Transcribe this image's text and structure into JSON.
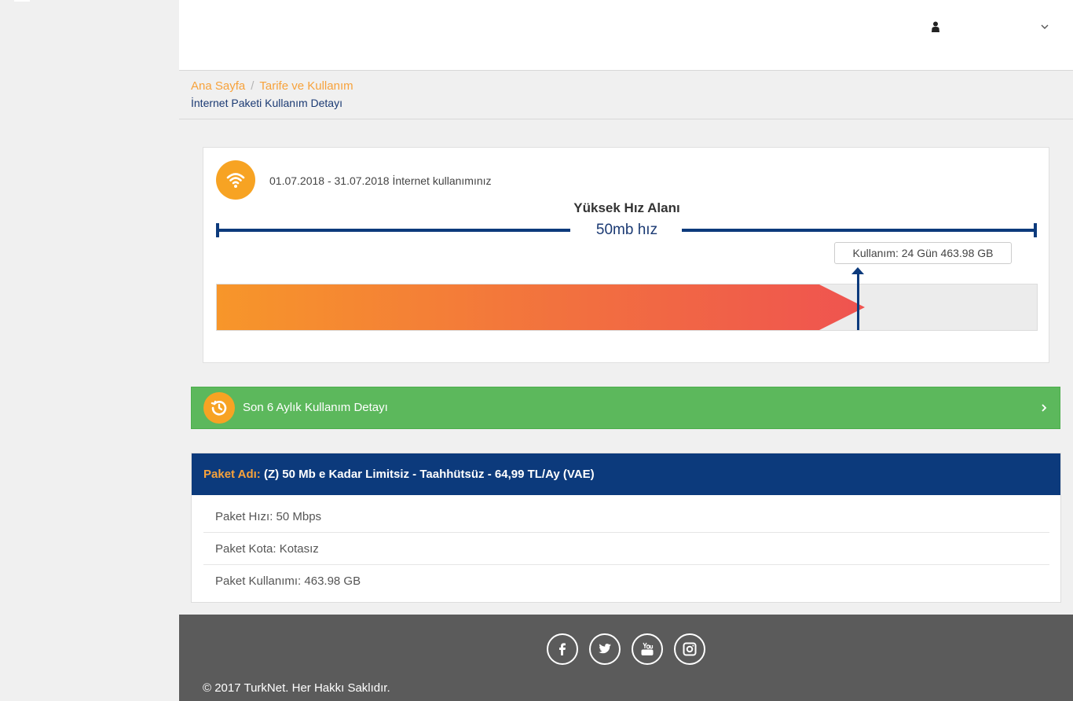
{
  "breadcrumb": {
    "home": "Ana Sayfa",
    "separator": "/",
    "section": "Tarife ve Kullanım",
    "page_title": "İnternet Paketi Kullanım Detayı"
  },
  "usage": {
    "period_text": "01.07.2018 - 31.07.2018 İnternet kullanımınız",
    "zone_title": "Yüksek Hız Alanı",
    "speed_label": "50mb hız",
    "usage_tag": "Kullanım: 24 Gün 463.98 GB",
    "progress_fraction": 0.79,
    "icon": "wifi-icon"
  },
  "history": {
    "label": "Son 6 Aylık Kullanım Detayı",
    "icon": "history-icon"
  },
  "package": {
    "name_key": "Paket Adı:",
    "name_value": "(Z) 50 Mb e Kadar Limitsiz - Taahhütsüz - 64,99 TL/Ay (VAE)",
    "rows": [
      "Paket Hızı: 50 Mbps",
      "Paket Kota: Kotasız",
      "Paket Kullanımı: 463.98 GB"
    ]
  },
  "footer": {
    "socials": [
      "facebook-icon",
      "twitter-icon",
      "youtube-icon",
      "instagram-icon"
    ],
    "copyright": "© 2017 TurkNet. Her Hakkı Saklıdır."
  },
  "colors": {
    "brand_navy": "#0c3a7c",
    "accent_orange": "#f7a323",
    "success_green": "#5cb85c",
    "footer_gray": "#5b5b5b"
  }
}
